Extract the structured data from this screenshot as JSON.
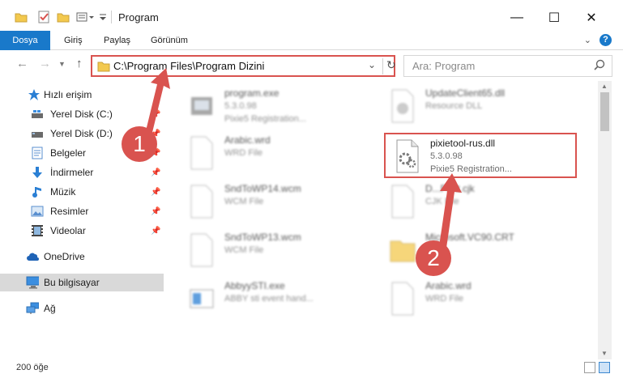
{
  "window": {
    "title": "Program",
    "minimize_glyph": "—",
    "maximize_glyph": "☐",
    "close_glyph": "✕"
  },
  "ribbon": {
    "tabs": [
      {
        "label": "Dosya",
        "active": true
      },
      {
        "label": "Giriş"
      },
      {
        "label": "Paylaş"
      },
      {
        "label": "Görünüm"
      }
    ]
  },
  "nav": {
    "address_path": "C:\\Program Files\\Program Dizini",
    "search_placeholder": "Ara: Program"
  },
  "sidebar": {
    "items": [
      {
        "label": "Hızlı erişim",
        "icon": "star-icon"
      },
      {
        "label": "Yerel Disk (C:)",
        "icon": "drive-icon",
        "pinned": true
      },
      {
        "label": "Yerel Disk (D:)",
        "icon": "drive-icon",
        "pinned": true
      },
      {
        "label": "Belgeler",
        "icon": "documents-icon",
        "pinned": true
      },
      {
        "label": "İndirmeler",
        "icon": "download-icon",
        "pinned": true
      },
      {
        "label": "Müzik",
        "icon": "music-icon",
        "pinned": true
      },
      {
        "label": "Resimler",
        "icon": "pictures-icon",
        "pinned": true
      },
      {
        "label": "Videolar",
        "icon": "video-icon",
        "pinned": true
      },
      {
        "label": "OneDrive",
        "icon": "cloud-icon"
      },
      {
        "label": "Bu bilgisayar",
        "icon": "computer-icon",
        "selected": true
      },
      {
        "label": "Ağ",
        "icon": "network-icon"
      }
    ]
  },
  "files": [
    {
      "name": "program.exe",
      "line1": "5.3.0.98",
      "line2": "Pixie5 Registration..."
    },
    {
      "name": "UpdateClient65.dll",
      "line1": "Resource DLL",
      "line2": ""
    },
    {
      "name": "Arabic.wrd",
      "line1": "WRD File",
      "line2": ""
    },
    {
      "name": "pixietool-rus.dll",
      "line1": "5.3.0.98",
      "line2": "Pixie5 Registration..."
    },
    {
      "name": "SndToWP14.wcm",
      "line1": "WCM File",
      "line2": ""
    },
    {
      "name": "D...Font.cjk",
      "line1": "CJK File",
      "line2": ""
    },
    {
      "name": "SndToWP13.wcm",
      "line1": "WCM File",
      "line2": ""
    },
    {
      "name": "Microsoft.VC90.CRT",
      "line1": "",
      "line2": ""
    },
    {
      "name": "AbbyySTI.exe",
      "line1": "ABBY sti event hand...",
      "line2": ""
    },
    {
      "name": "Arabic.wrd",
      "line1": "WRD File",
      "line2": ""
    }
  ],
  "status": {
    "count": "200 öğe"
  },
  "annotations": {
    "callout1": "1",
    "callout2": "2",
    "color": "#d9534f"
  },
  "colors": {
    "accent": "#1979ca",
    "highlight": "#d9534f"
  }
}
